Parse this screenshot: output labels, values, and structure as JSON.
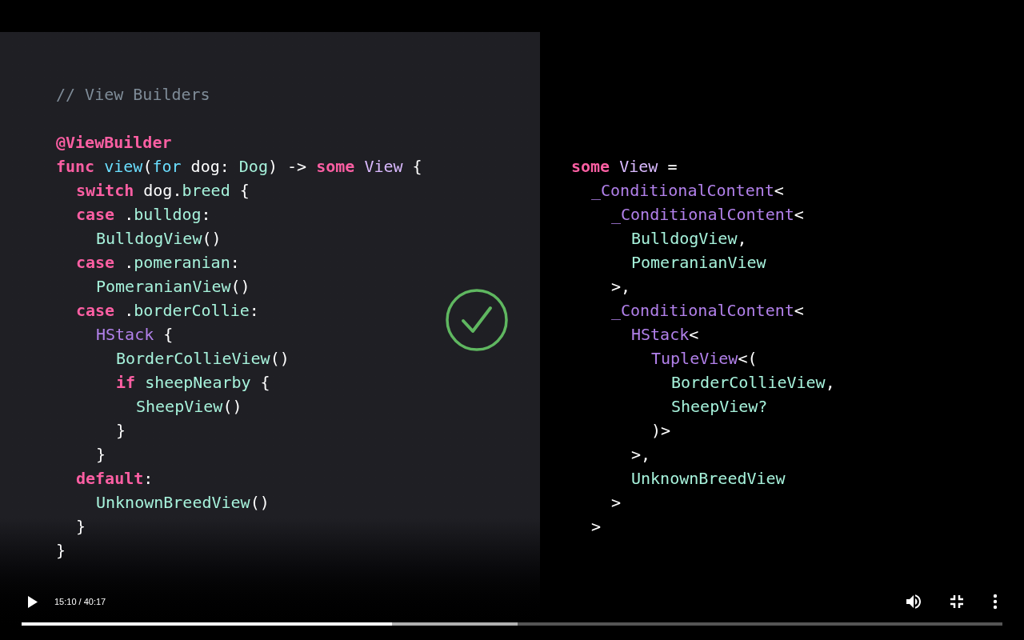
{
  "slide": {
    "left_code": {
      "comment": "// View Builders",
      "lines": [
        {
          "tokens": [
            {
              "text": "@ViewBuilder",
              "kind": "keyword"
            }
          ]
        },
        {
          "tokens": [
            {
              "text": "func ",
              "kind": "keyword"
            },
            {
              "text": "view",
              "kind": "function"
            },
            {
              "text": "(",
              "kind": "plain"
            },
            {
              "text": "for",
              "kind": "function"
            },
            {
              "text": " dog: ",
              "kind": "plain"
            },
            {
              "text": "Dog",
              "kind": "project"
            },
            {
              "text": ") -> ",
              "kind": "plain"
            },
            {
              "text": "some ",
              "kind": "keyword"
            },
            {
              "text": "View",
              "kind": "system"
            },
            {
              "text": " {",
              "kind": "plain"
            }
          ],
          "children": [
            {
              "tokens": [
                {
                  "text": "switch",
                  "kind": "keyword"
                },
                {
                  "text": " dog.",
                  "kind": "plain"
                },
                {
                  "text": "breed",
                  "kind": "project"
                },
                {
                  "text": " {",
                  "kind": "plain"
                }
              ]
            },
            {
              "tokens": [
                {
                  "text": "case",
                  "kind": "keyword"
                },
                {
                  "text": " .",
                  "kind": "plain"
                },
                {
                  "text": "bulldog",
                  "kind": "project"
                },
                {
                  "text": ":",
                  "kind": "plain"
                }
              ],
              "children": [
                {
                  "tokens": [
                    {
                      "text": "BulldogView",
                      "kind": "project"
                    },
                    {
                      "text": "()",
                      "kind": "plain"
                    }
                  ]
                }
              ]
            },
            {
              "tokens": [
                {
                  "text": "case",
                  "kind": "keyword"
                },
                {
                  "text": " .",
                  "kind": "plain"
                },
                {
                  "text": "pomeranian",
                  "kind": "project"
                },
                {
                  "text": ":",
                  "kind": "plain"
                }
              ],
              "children": [
                {
                  "tokens": [
                    {
                      "text": "PomeranianView",
                      "kind": "project"
                    },
                    {
                      "text": "()",
                      "kind": "plain"
                    }
                  ]
                }
              ]
            },
            {
              "tokens": [
                {
                  "text": "case",
                  "kind": "keyword"
                },
                {
                  "text": " .",
                  "kind": "plain"
                },
                {
                  "text": "borderCollie",
                  "kind": "project"
                },
                {
                  "text": ":",
                  "kind": "plain"
                }
              ],
              "children": [
                {
                  "tokens": [
                    {
                      "text": "HStack",
                      "kind": "type"
                    },
                    {
                      "text": " {",
                      "kind": "plain"
                    }
                  ],
                  "children": [
                    {
                      "tokens": [
                        {
                          "text": "BorderCollieView",
                          "kind": "project"
                        },
                        {
                          "text": "()",
                          "kind": "plain"
                        }
                      ]
                    },
                    {
                      "tokens": [
                        {
                          "text": "if ",
                          "kind": "keyword"
                        },
                        {
                          "text": "sheepNearby",
                          "kind": "project"
                        },
                        {
                          "text": " {",
                          "kind": "plain"
                        }
                      ],
                      "children": [
                        {
                          "tokens": [
                            {
                              "text": "SheepView",
                              "kind": "project"
                            },
                            {
                              "text": "()",
                              "kind": "plain"
                            }
                          ]
                        }
                      ]
                    },
                    {
                      "tokens": [
                        {
                          "text": "}",
                          "kind": "plain"
                        }
                      ]
                    }
                  ]
                },
                {
                  "tokens": [
                    {
                      "text": "}",
                      "kind": "plain"
                    }
                  ]
                }
              ]
            },
            {
              "tokens": [
                {
                  "text": "default",
                  "kind": "keyword"
                },
                {
                  "text": ":",
                  "kind": "plain"
                }
              ],
              "children": [
                {
                  "tokens": [
                    {
                      "text": "UnknownBreedView",
                      "kind": "project"
                    },
                    {
                      "text": "()",
                      "kind": "plain"
                    }
                  ]
                }
              ]
            },
            {
              "tokens": [
                {
                  "text": "}",
                  "kind": "plain"
                }
              ]
            }
          ]
        },
        {
          "tokens": [
            {
              "text": "}",
              "kind": "plain"
            }
          ]
        }
      ]
    },
    "right_code": {
      "lines": [
        {
          "tokens": [
            {
              "text": "some ",
              "kind": "keyword"
            },
            {
              "text": "View",
              "kind": "system"
            },
            {
              "text": " =",
              "kind": "plain"
            }
          ],
          "children": [
            {
              "tokens": [
                {
                  "text": "_ConditionalContent",
                  "kind": "type"
                },
                {
                  "text": "<",
                  "kind": "plain"
                }
              ],
              "children": [
                {
                  "tokens": [
                    {
                      "text": "_ConditionalContent",
                      "kind": "type"
                    },
                    {
                      "text": "<",
                      "kind": "plain"
                    }
                  ],
                  "children": [
                    {
                      "tokens": [
                        {
                          "text": "BulldogView",
                          "kind": "project"
                        },
                        {
                          "text": ",",
                          "kind": "plain"
                        }
                      ]
                    },
                    {
                      "tokens": [
                        {
                          "text": "PomeranianView",
                          "kind": "project"
                        }
                      ]
                    }
                  ]
                },
                {
                  "tokens": [
                    {
                      "text": ">,",
                      "kind": "plain"
                    }
                  ]
                },
                {
                  "tokens": [
                    {
                      "text": "_ConditionalContent",
                      "kind": "type"
                    },
                    {
                      "text": "<",
                      "kind": "plain"
                    }
                  ],
                  "children": [
                    {
                      "tokens": [
                        {
                          "text": "HStack",
                          "kind": "type"
                        },
                        {
                          "text": "<",
                          "kind": "plain"
                        }
                      ],
                      "children": [
                        {
                          "tokens": [
                            {
                              "text": "TupleView",
                              "kind": "type"
                            },
                            {
                              "text": "<(",
                              "kind": "plain"
                            }
                          ],
                          "children": [
                            {
                              "tokens": [
                                {
                                  "text": "BorderCollieView",
                                  "kind": "project"
                                },
                                {
                                  "text": ",",
                                  "kind": "plain"
                                }
                              ]
                            },
                            {
                              "tokens": [
                                {
                                  "text": "SheepView?",
                                  "kind": "project"
                                }
                              ]
                            }
                          ]
                        },
                        {
                          "tokens": [
                            {
                              "text": ")>",
                              "kind": "plain"
                            }
                          ]
                        }
                      ]
                    },
                    {
                      "tokens": [
                        {
                          "text": ">,",
                          "kind": "plain"
                        }
                      ]
                    },
                    {
                      "tokens": [
                        {
                          "text": "UnknownBreedView",
                          "kind": "project"
                        }
                      ]
                    }
                  ]
                },
                {
                  "tokens": [
                    {
                      "text": ">",
                      "kind": "plain"
                    }
                  ]
                }
              ]
            },
            {
              "tokens": [
                {
                  "text": ">",
                  "kind": "plain"
                }
              ]
            }
          ]
        }
      ]
    }
  },
  "controls": {
    "playing": false,
    "time": "15:10 / 40:17",
    "progress": [
      {
        "kind": "buffered",
        "level": 0.506
      },
      {
        "kind": "played",
        "level": 0.378
      }
    ]
  }
}
